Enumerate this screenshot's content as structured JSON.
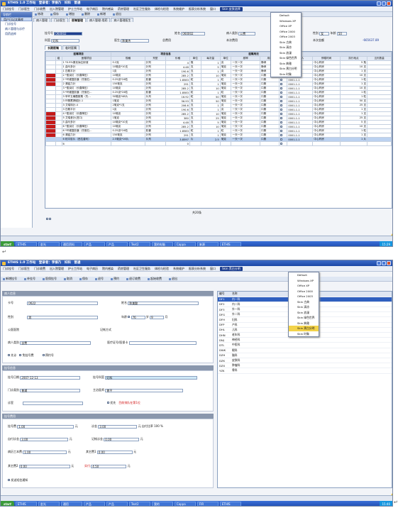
{
  "s1": {
    "title": "ETHIS 1.0 工作站　登录者：李振乃　妇科　普通",
    "menu": [
      "门诊挂号",
      "门诊医生",
      "门诊收费",
      "出入院管理",
      "护士工作站",
      "电子病历",
      "院内感染",
      "药房管理",
      "社区卫生服务",
      "体检与检验",
      "系统维护",
      "报表分析系统",
      "窗口",
      "Skin 皮肤选择"
    ],
    "toolbar": [
      "修改",
      "保存",
      "增加",
      "删除",
      "新增",
      "退出"
    ],
    "tabs": [
      "病人管理",
      "门诊医生",
      "医嘱管理",
      "病人管理-用药",
      "病人管理医生"
    ],
    "sidebar": {
      "header": "导航栏",
      "section": "用户日记文章库",
      "items": [
        "门诊挂号",
        "病人管理与诊疗",
        "用药退库"
      ]
    },
    "fields": {
      "card_label": "挂号号",
      "card_value": "060002",
      "name_label": "姓名",
      "name_value": "060002",
      "type_label": "病人类别",
      "type_value": "公费",
      "dept_label": "科室",
      "dept_value": "妇科",
      "doctor_label": "医生",
      "doctor_value": "陈美杰",
      "total_label": "总费用",
      "balance_label": "本次费用",
      "gender_label": "性别",
      "gender_value": "女",
      "age_label": "年龄",
      "age_value": "50",
      "amount": "-665637.89",
      "stock_label": "本次金额"
    },
    "subtabs": [
      "长期医嘱",
      "临时医嘱"
    ],
    "grid": {
      "groups": [
        "医嘱项目",
        "项目信息",
        "医嘱用法"
      ],
      "headers": [
        "",
        "组",
        "医嘱项目",
        "规格",
        "剂型",
        "价格",
        "单位",
        "每次量",
        "单位",
        "频率",
        "用法"
      ],
      "right_headers": [
        "嘱医人",
        "停嘱时间",
        "执行地点",
        "当天数量"
      ],
      "rows": [
        [
          "",
          "",
          "1 *0.9%氯化钠注射液",
          "0.2克",
          "针剂",
          "4",
          "瓶",
          "1",
          "克",
          "一天一次",
          "静滴",
          "0001-1-1",
          "中心药房",
          "5 瓶"
        ],
        [
          "",
          "",
          "1 曲马多针",
          "10毫克*10支",
          "针剂",
          "4.48",
          "支",
          "5",
          "毫克",
          "一天一次",
          "静滴",
          "0001-1-1",
          "中心药房",
          "10 支"
        ],
        [
          "",
          "",
          "1 匹氨平针",
          "1克",
          "针剂",
          "190.6",
          "支",
          "1",
          "克",
          "一天一次",
          "静滴",
          "0001-1-1",
          "中心药房",
          "1 支"
        ],
        [
          "r",
          "",
          "2 *氢溴钉（长春降压）",
          "10毫克",
          "针剂",
          "285.2",
          "支",
          "10",
          "毫克",
          "一天一次",
          "口服",
          "0001-1-1",
          "中心药房",
          "10 支"
        ],
        [
          "r",
          "",
          "2 *环缠复胶囊（先驱石...",
          "0.25克*24粒",
          "胶囊",
          "1.8583",
          "粒",
          "1",
          "粒",
          "一天一次",
          "口服",
          "0001-1-1",
          "中心药房",
          "1 粒"
        ],
        [
          "r",
          "",
          "2 清瘟力针",
          "150毫克",
          "针剂",
          "291",
          "支",
          "1",
          "毫克",
          "一天一次",
          "口服",
          "0001-1-1",
          "中心药房",
          "1 支"
        ],
        [
          "",
          "",
          "3 *氢溴钉（长春降压）",
          "10毫克",
          "针剂",
          "285.2",
          "支",
          "10",
          "毫克",
          "一天一次",
          "口服",
          "0001-1-1",
          "中心药房",
          "10 支"
        ],
        [
          "",
          "",
          "3 *环缠复胶囊（先驱石...",
          "0.25克*24粒",
          "胶囊",
          "1.8583",
          "粒",
          "1",
          "粒",
          "一天一次",
          "口服",
          "0001-1-1",
          "中心药房",
          "1 粒"
        ],
        [
          "",
          "",
          "3 甲环五磺酸胺素（先...",
          "50毫克*48片",
          "片剂",
          "16.92",
          "粒",
          "50",
          "毫克",
          "一天一次",
          "口服",
          "0001-1-1",
          "中心药房",
          "1 粒"
        ],
        [
          "",
          "",
          "3 环基蓄钾磁针-1",
          "1毫克",
          "针剂",
          "56.93",
          "支",
          "50",
          "毫克",
          "一天一次",
          "口服",
          "0001-1-1",
          "中心药房",
          "50 支"
        ],
        [
          "",
          "",
          "3 艾瑞特针-4",
          "2毫克*1支",
          "针剂",
          "206.6",
          "支",
          "1",
          "克",
          "一天一次",
          "口服",
          "0001-1-1",
          "中心药房",
          "25 支"
        ],
        [
          "",
          "",
          "3 匹氨平针",
          "1克",
          "针剂",
          "190.6",
          "支",
          "1",
          "克",
          "一天一次",
          "口服",
          "0001-1-1",
          "中心药房",
          "1 支"
        ],
        [
          "r",
          "",
          "4 *氢溴钉（长春降压）",
          "10毫克",
          "针剂",
          "285.2",
          "支",
          "10",
          "毫克",
          "一天一次",
          "口服",
          "0001-1-1",
          "中心药房",
          "1 支"
        ],
        [
          "r",
          "",
          "5 艾瑞昔针(进口)",
          "1毫克",
          "针剂",
          "380",
          "支",
          "25",
          "毫克",
          "一天一次",
          "口服",
          "0001-1-1",
          "中心药房",
          "25 支"
        ],
        [
          "r",
          "",
          "5 曲马多针",
          "10毫克*10支",
          "针剂",
          "4.48",
          "支",
          "5",
          "毫克",
          "一天一次",
          "口服",
          "0001-1-1",
          "中心药房",
          "5 支"
        ],
        [
          "r",
          "",
          "6 *氢溴钉（长春降压）",
          "10毫克",
          "针剂",
          "285.2",
          "支",
          "10",
          "毫克",
          "一天一次",
          "口服",
          "0001-1-1",
          "中心药房",
          "10 支"
        ],
        [
          "r",
          "",
          "6 *环缠复胶囊（先驱石...",
          "0.25克*24粒",
          "胶囊",
          "1.8583",
          "粒",
          "1",
          "粒",
          "一天一次",
          "口服",
          "0001-1-1",
          "中心药房",
          "1 粒"
        ],
        [
          "r",
          "",
          "6 清瘟力针",
          "150毫克",
          "针剂",
          "291",
          "支",
          "1",
          "毫克",
          "一天一次",
          "口服",
          "0001-1-1",
          "中心药房",
          "1 支"
        ],
        [
          "h",
          "",
          "6 帕平胶片（西拉普利）",
          "2.5毫克*16片",
          "片剂",
          "3.8597",
          "片",
          "2.5",
          "毫克",
          "一天一次",
          "口服",
          "0001-1-1",
          "中心药房",
          "1 片"
        ],
        [
          "",
          "",
          "6",
          "",
          "",
          "0",
          "",
          "",
          "",
          "",
          "",
          "",
          "",
          ""
        ]
      ],
      "footer": "共20条"
    },
    "skins": [
      "Default",
      "Windows XP",
      "Office XP",
      "Office 2000",
      "Office 2003",
      "Skin 古典",
      "Skin 清凉",
      "Skin 浪漫",
      "Skin 绿色世界",
      "Skin 典雅",
      "Skin 黑白分明",
      "Skin 时象"
    ],
    "taskbar": [
      "ETHIS",
      "金光",
      "通用资料",
      "产品",
      "产品",
      "Text2",
      "我的电脑",
      "Cappa",
      "来源",
      "ETHIS"
    ],
    "clock": "15:29"
  },
  "s2": {
    "title": "ETHIS 1.0 工作站　登录者：李振乃　妇科　普通",
    "menu": [
      "门诊挂号",
      "门诊医生",
      "门诊收费",
      "出入院管理",
      "护士工作站",
      "电子病历",
      "院内感染",
      "药房管理",
      "社区卫生服务",
      "体检与检验",
      "系统维护",
      "报表分析系统",
      "窗口",
      "Skin 黑白分明"
    ],
    "toolbar": [
      "新增挂号",
      "补挂号",
      "医保挂号",
      "取消",
      "保存",
      "退号",
      "预约",
      "退订收费",
      "起始收费",
      "退出"
    ],
    "sections": {
      "patient": "病人信息",
      "reg": "挂号信息",
      "fee": "挂号费用"
    },
    "patient": {
      "card_label": "卡号",
      "card_value": "0622",
      "name_label": "姓名",
      "name_value": "陈美勤",
      "gender_label": "性别",
      "gender_value": "男",
      "age_label": "年龄",
      "age_value": "76",
      "age_unit": "岁",
      "month_value": "9",
      "month_unit": "月",
      "company_label": "公医医院",
      "record_label": "记帐方式",
      "ptype_label": "病人类别",
      "ptype_value": "自费",
      "insure_label": "医疗证号/医保卡",
      "first_label": "先诊",
      "nofee_label": "免挂号费",
      "appt_label": "预约号"
    },
    "reg": {
      "date_label": "挂号日期",
      "date_value": "2007-12-13",
      "dept_label": "挂号科室",
      "dept_value": "妇科",
      "type_label": "门诊类别",
      "type_value": "普通",
      "doctor_label": "主治医师",
      "doctor_value": "曾平",
      "room_label": "诊室",
      "first_label": "优先",
      "hint": "目前排队在第1位"
    },
    "fee": {
      "reg_label": "挂号费",
      "reg_value": "1.00",
      "unit": "元",
      "diag_label": "诊金",
      "diag_value": "3.00",
      "selfpay_label": "自付比率",
      "selfpay_value": "100",
      "pct": "%",
      "selfreg_label": "自付诊金",
      "selfreg_value": "3.00",
      "record_label": "记帐诊金",
      "record_value": "0.00",
      "book_label": "病历工本费",
      "book_value": "1.00",
      "other1_label": "其它费1",
      "other1_value": "0.00",
      "other2_label": "其它费2",
      "other2_value": "0.00",
      "real_label": "实付",
      "real_value": "4.50",
      "notify_label": "发送短信通知"
    },
    "dept_list": {
      "col1": "编号",
      "col2": "名称",
      "rows": [
        [
          "DF1",
          "内一科"
        ],
        [
          "DF2",
          "内二科"
        ],
        [
          "DF3",
          "外一科"
        ],
        [
          "DFG",
          "外二科"
        ],
        [
          "DFH",
          "妇科"
        ],
        [
          "DFP",
          "产科"
        ],
        [
          "DHL",
          "儿科"
        ],
        [
          "DHN",
          "老年科"
        ],
        [
          "DNJ",
          "神经科"
        ],
        [
          "DTL",
          "中医科"
        ],
        [
          "DWK",
          "眼科"
        ],
        [
          "DZH",
          "脑科"
        ],
        [
          "DZK",
          "皮肤科"
        ],
        [
          "DZX",
          "肿瘤科"
        ],
        [
          "YZK",
          "骨科"
        ]
      ]
    },
    "skins": [
      "Default",
      "Windows XP",
      "Office XP",
      "Office 2000",
      "Office 2003",
      "Skin 古典",
      "Skin 清凉",
      "Skin 浪漫",
      "Skin 绿色世界",
      "Skin 典雅",
      "Skin 黑白分明",
      "Skin 时象"
    ],
    "taskbar": [
      "ETHIS",
      "金光",
      "通用",
      "产品",
      "产品",
      "Text2",
      "我的",
      "Cappa",
      "FIR",
      "ETHIS"
    ],
    "clock": "15:40"
  },
  "para": "↵"
}
